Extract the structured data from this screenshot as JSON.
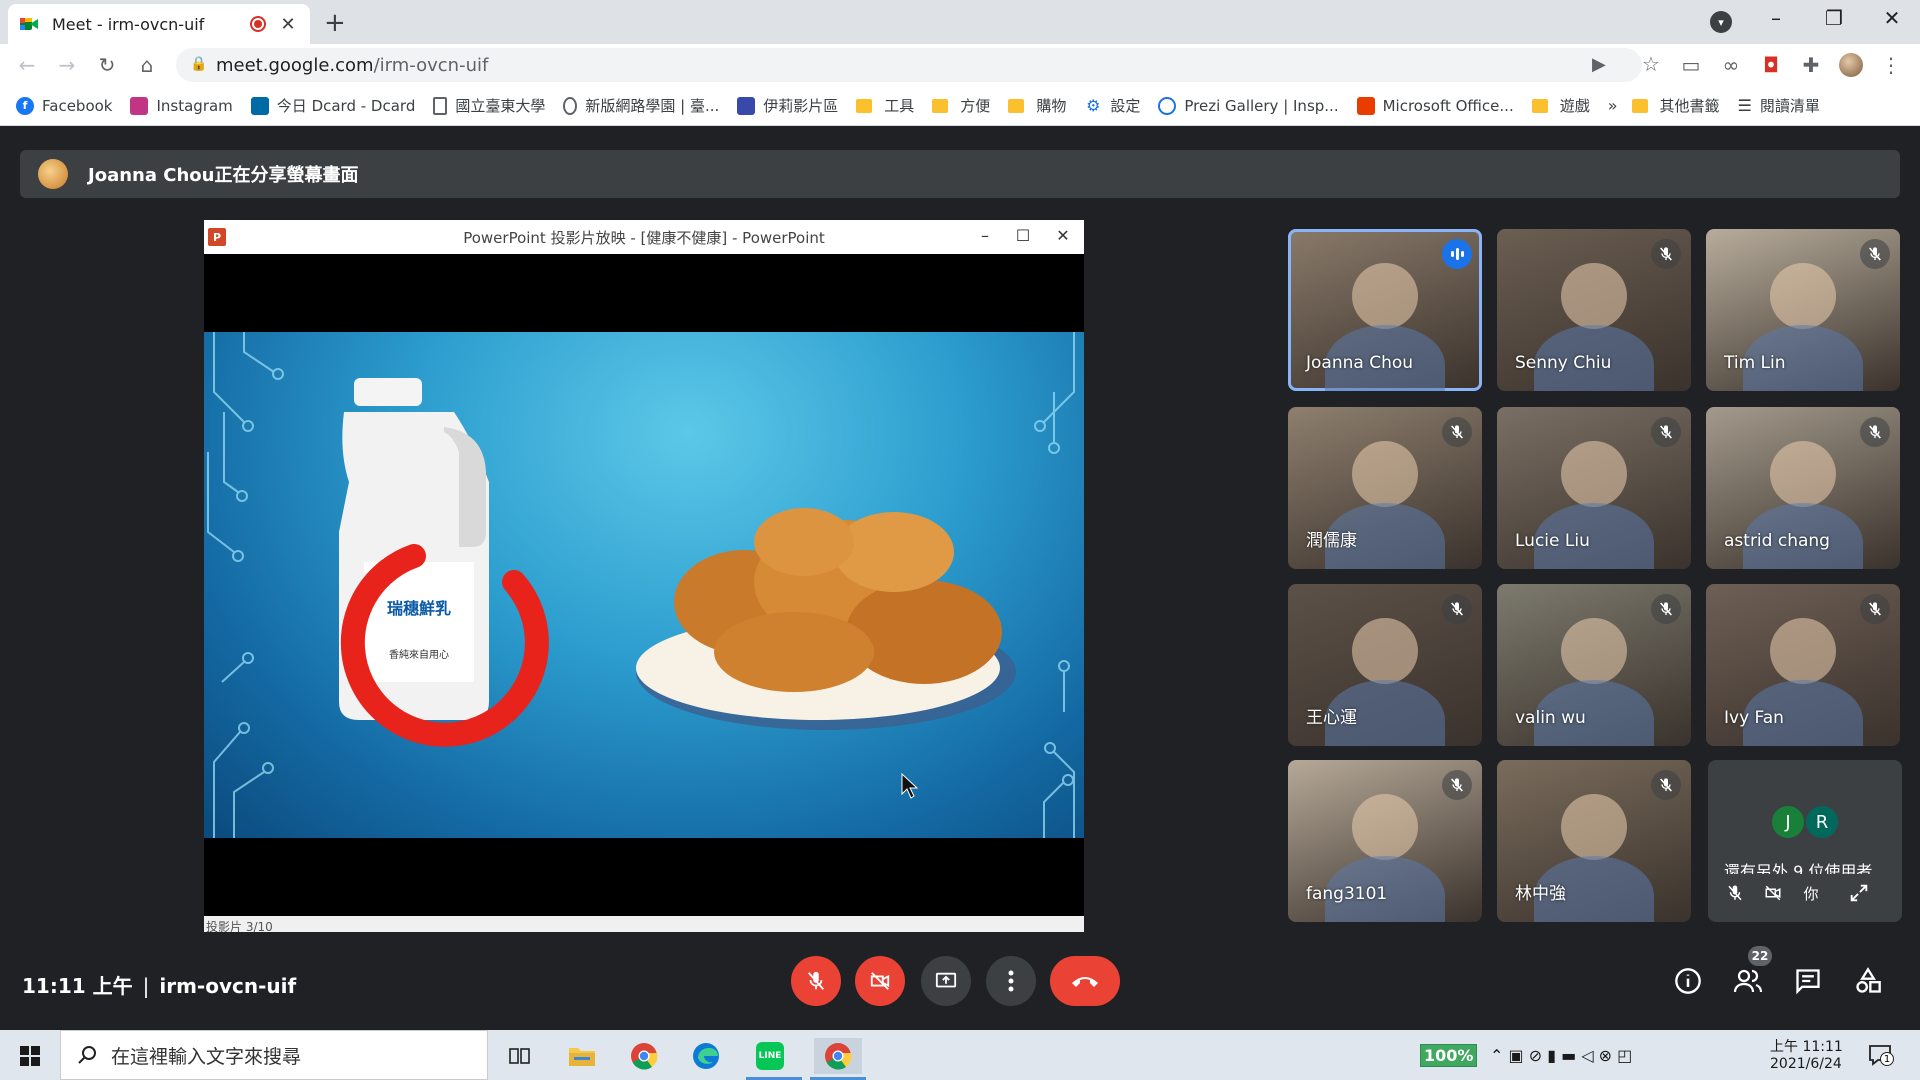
{
  "browser": {
    "tab_title": "Meet - irm-ovcn-uif",
    "url_host": "meet.google.com",
    "url_path": "/irm-ovcn-uif",
    "close_glyph": "✕",
    "new_tab_glyph": "+"
  },
  "bookmarks": [
    {
      "label": "Facebook",
      "icon": "facebook-icon",
      "color": "#1877f2"
    },
    {
      "label": "Instagram",
      "icon": "instagram-icon",
      "color": "#c13584"
    },
    {
      "label": "今日 Dcard - Dcard",
      "icon": "dcard-icon",
      "color": "#006aa6"
    },
    {
      "label": "國立臺東大學",
      "icon": "page-icon",
      "color": "#5f6368"
    },
    {
      "label": "新版網路學園 | 臺...",
      "icon": "globe-icon",
      "color": "#5f6368"
    },
    {
      "label": "伊莉影片區",
      "icon": "eyny-icon",
      "color": "#3949ab"
    },
    {
      "label": "工具",
      "icon": "folder-icon",
      "color": "#fbc02d"
    },
    {
      "label": "方便",
      "icon": "folder-icon",
      "color": "#fbc02d"
    },
    {
      "label": "購物",
      "icon": "folder-icon",
      "color": "#fbc02d"
    },
    {
      "label": "設定",
      "icon": "gear-icon",
      "color": "#1a73e8"
    },
    {
      "label": "Prezi Gallery | Insp...",
      "icon": "prezi-icon",
      "color": "#1a73e8"
    },
    {
      "label": "Microsoft Office...",
      "icon": "office-icon",
      "color": "#eb3c00"
    },
    {
      "label": "遊戲",
      "icon": "folder-icon",
      "color": "#fbc02d"
    }
  ],
  "bookmarks_more": "»",
  "bookmarks_other": "其他書籤",
  "bookmarks_reading_list": "閱讀清單",
  "meet": {
    "presenter_banner": "Joanna Chou正在分享螢幕畫面",
    "ppt_title": "PowerPoint 投影片放映 - [健康不健康] - PowerPoint",
    "ppt_status": "投影片 3/10",
    "participants": [
      {
        "name": "Joanna Chou",
        "muted": false,
        "speaking": true,
        "bg": "#8a7a6a"
      },
      {
        "name": "Senny Chiu",
        "muted": true,
        "speaking": false,
        "bg": "#6b5e52"
      },
      {
        "name": "Tim Lin",
        "muted": true,
        "speaking": false,
        "bg": "#b8ad9c"
      },
      {
        "name": "潤儒康",
        "muted": true,
        "speaking": false,
        "bg": "#8e7f6e"
      },
      {
        "name": "Lucie Liu",
        "muted": true,
        "speaking": false,
        "bg": "#7a6f64"
      },
      {
        "name": "astrid chang",
        "muted": true,
        "speaking": false,
        "bg": "#a49a8c"
      },
      {
        "name": "王心運",
        "muted": true,
        "speaking": false,
        "bg": "#5c5148"
      },
      {
        "name": "valin wu",
        "muted": true,
        "speaking": false,
        "bg": "#7d7a6e"
      },
      {
        "name": "Ivy Fan",
        "muted": true,
        "speaking": false,
        "bg": "#6e5f55"
      },
      {
        "name": "fang3101",
        "muted": true,
        "speaking": false,
        "bg": "#b6a998"
      },
      {
        "name": "林中強",
        "muted": true,
        "speaking": false,
        "bg": "#7a6c5c"
      }
    ],
    "others": {
      "avatars": [
        {
          "letter": "J",
          "color": "#188038"
        },
        {
          "letter": "R",
          "color": "#00695c"
        }
      ],
      "text": "還有另外 9 位使用者",
      "self_label": "你"
    },
    "time": "11:11 上午",
    "meeting_code": "irm-ovcn-uif",
    "participant_count": "22"
  },
  "taskbar": {
    "search_placeholder": "在這裡輸入文字來搜尋",
    "battery": "100%",
    "time": "上午 11:11",
    "date": "2021/6/24",
    "notif_count": "1"
  }
}
